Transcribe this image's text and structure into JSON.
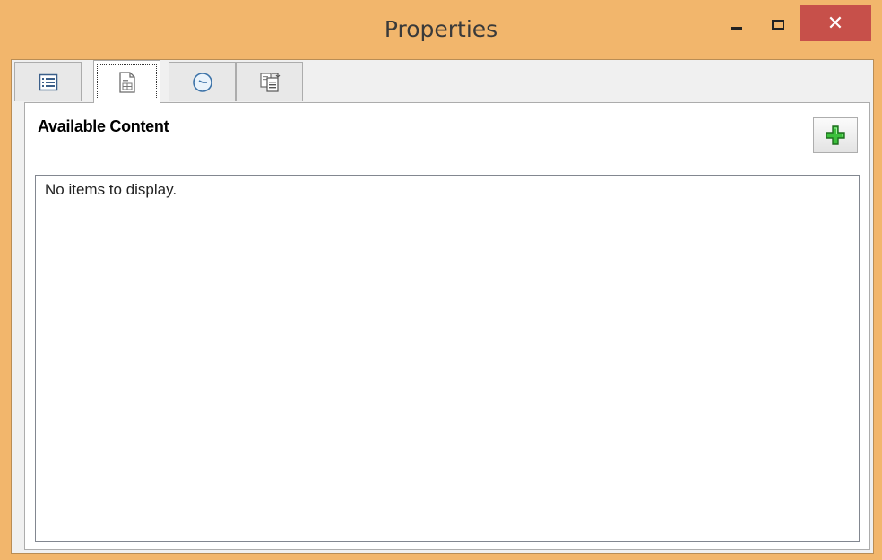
{
  "window": {
    "title": "Properties",
    "close_glyph": "✕"
  },
  "tabs": [
    {
      "icon": "list-icon",
      "selected": false
    },
    {
      "icon": "content-page-icon",
      "selected": true
    },
    {
      "icon": "clock-icon",
      "selected": false
    },
    {
      "icon": "document-stack-icon",
      "selected": false
    }
  ],
  "content": {
    "heading": "Available Content",
    "add_icon": "green-plus-icon",
    "empty_message": "No items to display."
  },
  "colors": {
    "titlebar": "#f2b66c",
    "close_button": "#c7504a",
    "add_icon_green": "#2aa52a"
  }
}
